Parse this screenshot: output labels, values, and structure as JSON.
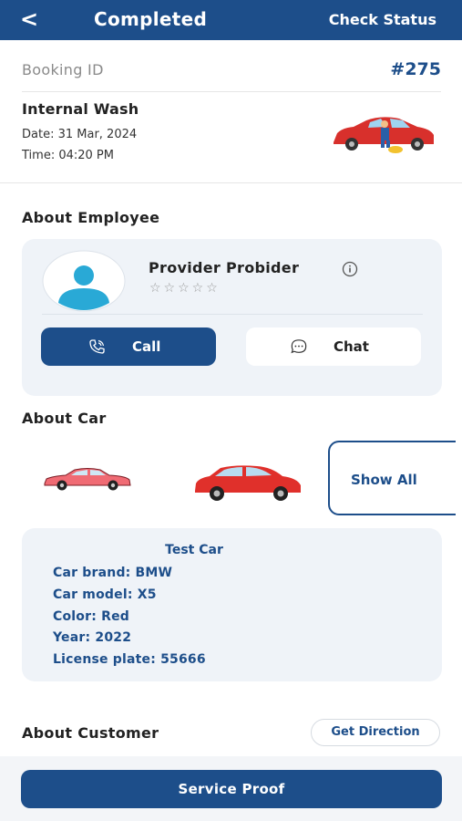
{
  "header": {
    "back_icon": "chevron-left-icon",
    "title": "Completed",
    "check_status_label": "Check Status"
  },
  "booking": {
    "id_label": "Booking ID",
    "id_value": "#275"
  },
  "service": {
    "name": "Internal Wash",
    "date": "Date: 31 Mar, 2024",
    "time": "Time: 04:20 PM",
    "image_icon": "car-wash-illustration"
  },
  "employee": {
    "section_title": "About Employee",
    "name": "Provider Probider",
    "rating_stars": "☆☆☆☆☆",
    "rating_value": 0,
    "call_label": "Call",
    "chat_label": "Chat"
  },
  "car": {
    "section_title": "About Car",
    "show_all_label": "Show All",
    "details_title": "Test Car",
    "brand": "Car brand: BMW",
    "model": "Car model: X5",
    "color": "Color: Red",
    "year": "Year: 2022",
    "plate": "License plate: 55666"
  },
  "customer": {
    "section_title": "About Customer",
    "get_direction_label": "Get Direction"
  },
  "footer": {
    "service_proof_label": "Service Proof"
  },
  "colors": {
    "primary": "#1d4e8a",
    "card_bg": "#eff3f8",
    "car_red": "#e0302b",
    "avatar": "#29a9d6"
  }
}
